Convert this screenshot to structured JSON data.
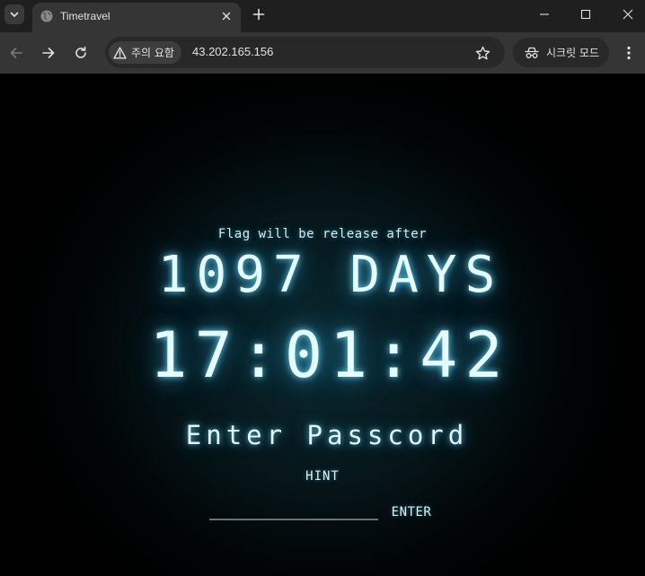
{
  "browser": {
    "tab": {
      "title": "Timetravel",
      "favicon": "globe-icon"
    },
    "window_controls": [
      "minimize-icon",
      "maximize-icon",
      "close-icon"
    ],
    "security_chip_label": "주의 요함",
    "url": "43.202.165.156",
    "incognito_label": "시크릿 모드",
    "icons": {
      "tab_list": "chevron-down-icon",
      "new_tab": "plus-icon",
      "back": "arrow-left-icon",
      "forward": "arrow-right-icon",
      "reload": "reload-icon",
      "security": "warning-icon",
      "bookmark": "star-icon",
      "incognito": "incognito-icon",
      "menu": "kebab-menu-icon"
    }
  },
  "page": {
    "subtitle": "Flag will be release after",
    "days_text": "1097 DAYS",
    "clock_text": "17:01:42",
    "heading": "Enter Passcord",
    "hint_label": "HINT",
    "passcode_value": "",
    "enter_label": "ENTER"
  },
  "colors": {
    "glow": "#5ad0f0",
    "text": "#e6fbff",
    "background": "#000000",
    "vignette_center": "#0c2a31",
    "input_underline": "#6d6f70"
  }
}
